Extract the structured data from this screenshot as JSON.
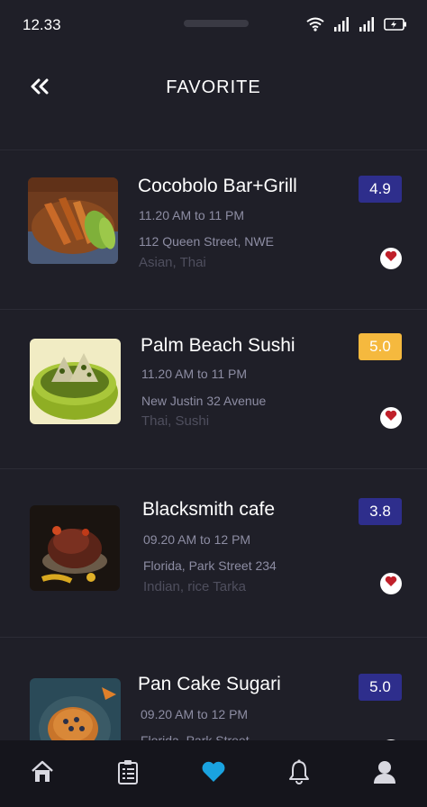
{
  "status_bar": {
    "time": "12.33"
  },
  "header": {
    "title": "FAVORITE",
    "back_icon": "double-chevron-left-icon"
  },
  "colors": {
    "background": "#1f1f28",
    "rating_blue": "#2e2e8c",
    "rating_yellow": "#f5b93e",
    "heart_red": "#c0202a",
    "nav_active": "#1aa3e0",
    "muted_text": "#8d8da3"
  },
  "restaurants": [
    {
      "name": "Cocobolo Bar+Grill",
      "hours": "11.20 AM to 11 PM",
      "address": "112 Queen Street, NWE",
      "cuisine": "Asian, Thai",
      "rating": "4.9",
      "rating_color": "blue"
    },
    {
      "name": "Palm Beach Sushi",
      "hours": "11.20 AM to 11 PM",
      "address": "New Justin 32 Avenue",
      "cuisine": "Thai, Sushi",
      "rating": "5.0",
      "rating_color": "yellow"
    },
    {
      "name": "Blacksmith cafe",
      "hours": "09.20 AM to 12 PM",
      "address": "Florida, Park Street 234",
      "cuisine": "Indian, rice Tarka",
      "rating": "3.8",
      "rating_color": "blue"
    },
    {
      "name": "Pan Cake Sugari",
      "hours": "09.20 AM to 12 PM",
      "address": "Florida, Park Street",
      "cuisine": "",
      "rating": "5.0",
      "rating_color": "blue"
    }
  ],
  "bottom_nav": {
    "items": [
      {
        "icon": "home-icon",
        "active": false
      },
      {
        "icon": "list-icon",
        "active": false
      },
      {
        "icon": "heart-icon",
        "active": true
      },
      {
        "icon": "bell-icon",
        "active": false
      },
      {
        "icon": "user-icon",
        "active": false
      }
    ]
  }
}
